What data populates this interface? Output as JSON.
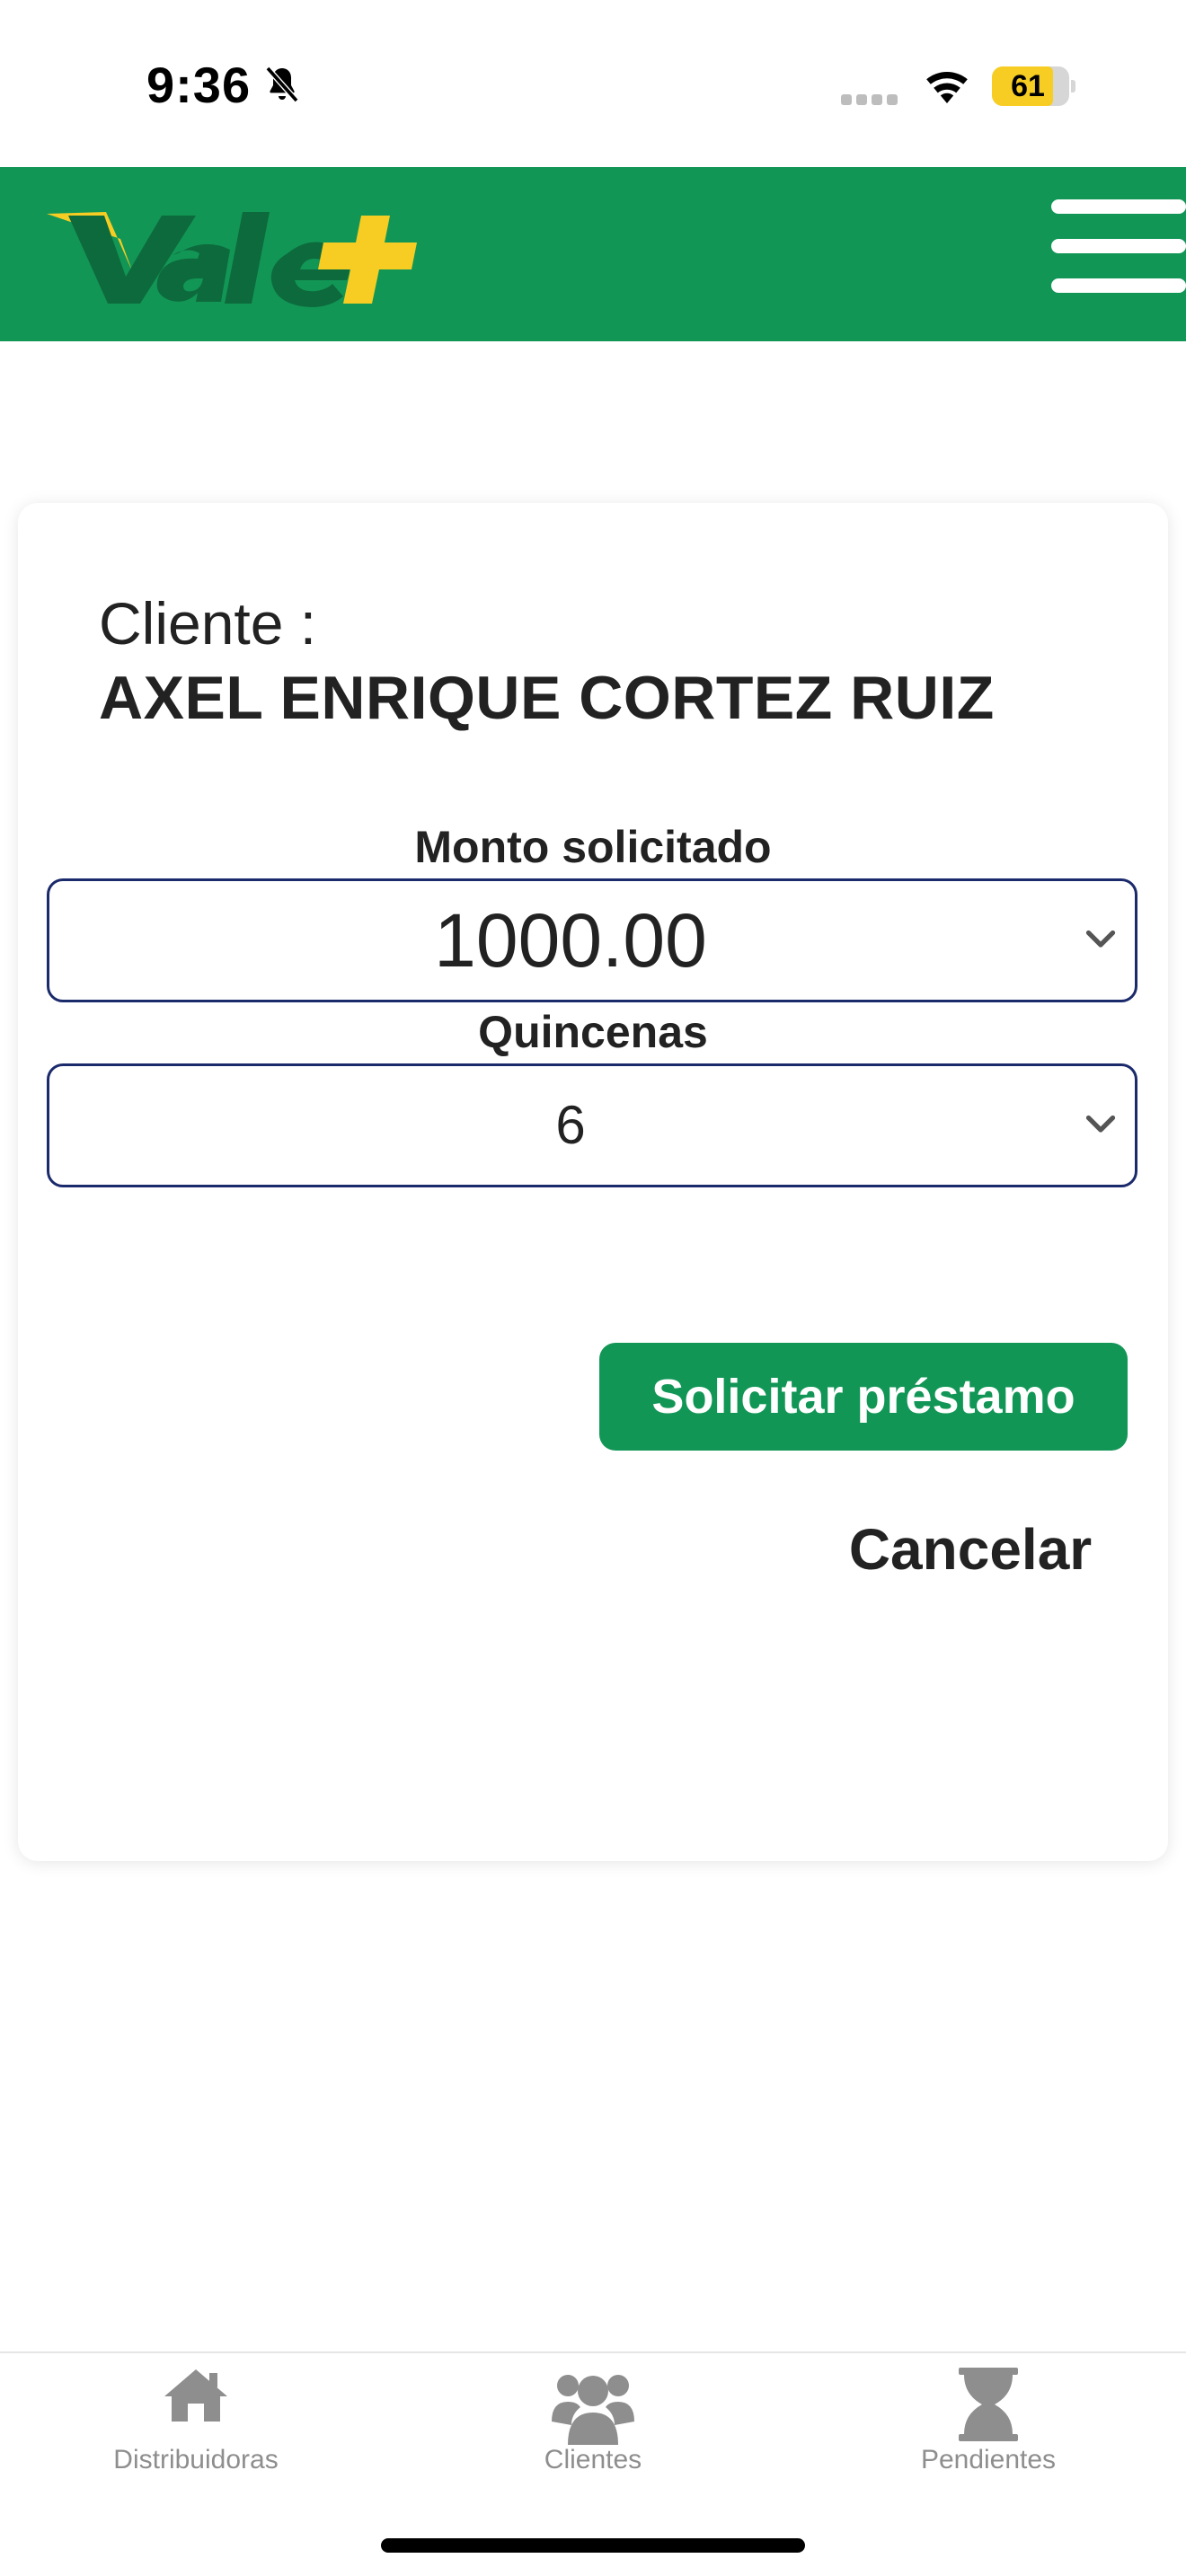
{
  "status_bar": {
    "time": "9:36",
    "battery": "61",
    "icons": [
      "bell-off-icon",
      "signal-icon",
      "wifi-icon",
      "battery-icon"
    ]
  },
  "header": {
    "logo_text": "Vale+",
    "menu_icon": "hamburger-menu-icon",
    "brand_color": "#129656",
    "accent_color": "#F7CD23"
  },
  "form": {
    "client_label": "Cliente :",
    "client_name": "AXEL ENRIQUE CORTEZ RUIZ",
    "amount_label": "Monto solicitado",
    "amount_value": "1000.00",
    "periods_label": "Quincenas",
    "periods_value": "6",
    "submit_label": "Solicitar préstamo",
    "cancel_label": "Cancelar"
  },
  "tab_bar": {
    "tabs": [
      {
        "label": "Distribuidoras",
        "icon": "home-icon"
      },
      {
        "label": "Clientes",
        "icon": "users-icon"
      },
      {
        "label": "Pendientes",
        "icon": "hourglass-icon"
      }
    ]
  }
}
